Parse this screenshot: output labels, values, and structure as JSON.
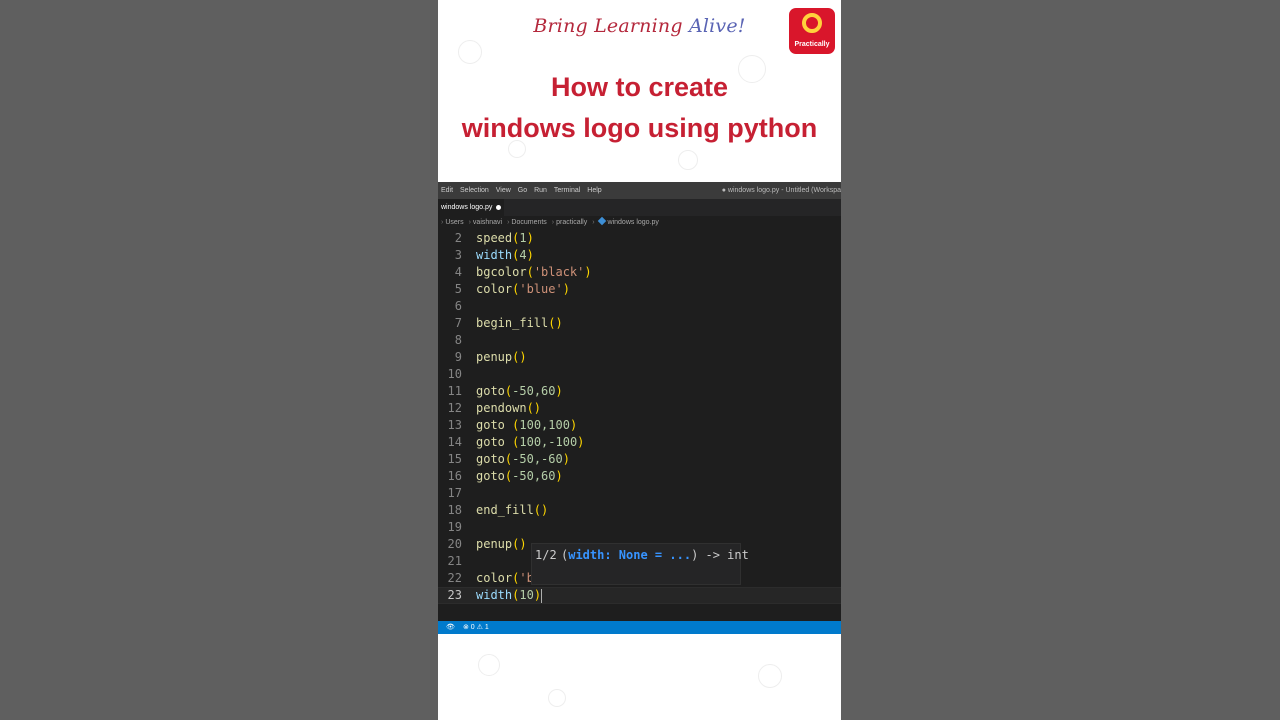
{
  "banner": {
    "tagline_part1": "Bring Learning",
    "tagline_part2": "Alive!",
    "logo_text": "Practically",
    "headline_line1": "How to create",
    "headline_line2": "windows logo using python"
  },
  "vscode": {
    "menu": [
      "Edit",
      "Selection",
      "View",
      "Go",
      "Run",
      "Terminal",
      "Help"
    ],
    "window_title": "● windows logo.py - Untitled (Workspa",
    "tab_label": "windows logo.py",
    "breadcrumb": [
      "Users",
      "vaishnavi",
      "Documents",
      "practically",
      "windows logo.py"
    ],
    "line_numbers": [
      "2",
      "3",
      "4",
      "5",
      "6",
      "7",
      "8",
      "9",
      "10",
      "11",
      "12",
      "13",
      "14",
      "15",
      "16",
      "17",
      "18",
      "19",
      "20",
      "21",
      "22",
      "23"
    ],
    "code": {
      "l2": {
        "name": "speed",
        "open": "(",
        "arg": "1",
        "close": ")"
      },
      "l3": {
        "name": "width",
        "open": "(",
        "arg": "4",
        "close": ")"
      },
      "l4": {
        "name": "bgcolor",
        "open": "(",
        "arg": "'black'",
        "close": ")"
      },
      "l5": {
        "name": "color",
        "open": "(",
        "arg": "'blue'",
        "close": ")"
      },
      "l7": {
        "name": "begin_fill",
        "parens": "()"
      },
      "l9": {
        "name": "penup",
        "parens": "()"
      },
      "l11": {
        "name": "goto",
        "open": "(",
        "arg": "-50,60",
        "close": ")"
      },
      "l12": {
        "name": "pendown",
        "parens": "()"
      },
      "l13": {
        "name": "goto",
        "space": " ",
        "open": "(",
        "arg": "100,100",
        "close": ")"
      },
      "l14": {
        "name": "goto",
        "space": " ",
        "open": "(",
        "arg": "100,-100",
        "close": ")"
      },
      "l15": {
        "name": "goto",
        "open": "(",
        "arg": "-50,-60",
        "close": ")"
      },
      "l16": {
        "name": "goto",
        "open": "(",
        "arg": "-50,60",
        "close": ")"
      },
      "l18": {
        "name": "end_fill",
        "parens": "()"
      },
      "l20": {
        "name": "penup",
        "parens": "()"
      },
      "l22": {
        "name": "color",
        "open": "(",
        "arg": "'b"
      },
      "l23": {
        "name": "width",
        "open": "(",
        "arg": "10",
        "close": ")"
      }
    },
    "signature_hint": {
      "count": "1/2",
      "open": "(",
      "param": "width: None = ...",
      "rest": ") -> int"
    },
    "status": {
      "eye_icon": "👁",
      "problems": "⊗ 0 ⚠ 1"
    }
  }
}
